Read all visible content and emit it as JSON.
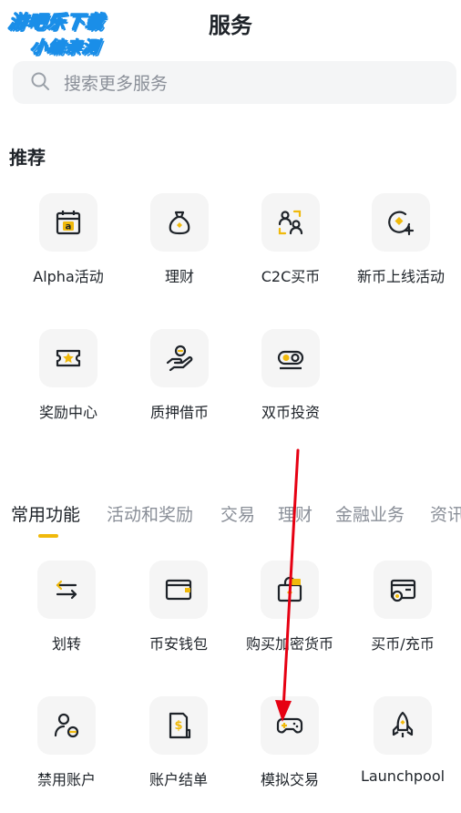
{
  "watermark": {
    "line1": "游吧乐下载",
    "line2": "小编亲测"
  },
  "header": {
    "title": "服务"
  },
  "search": {
    "placeholder": "搜索更多服务"
  },
  "recommend": {
    "title": "推荐",
    "items": [
      {
        "label": "Alpha活动",
        "icon": "alpha-calendar-icon"
      },
      {
        "label": "理财",
        "icon": "money-bag-icon"
      },
      {
        "label": "C2C买币",
        "icon": "users-exchange-icon"
      },
      {
        "label": "新币上线活动",
        "icon": "new-coin-icon"
      },
      {
        "label": "奖励中心",
        "icon": "ticket-star-icon"
      },
      {
        "label": "质押借币",
        "icon": "hand-coin-icon"
      },
      {
        "label": "双币投资",
        "icon": "dual-coin-icon"
      }
    ]
  },
  "tabs": [
    "常用功能",
    "活动和奖励",
    "交易",
    "理财",
    "金融业务",
    "资讯"
  ],
  "active_tab": "常用功能",
  "features": {
    "items": [
      {
        "label": "划转",
        "icon": "transfer-arrows-icon"
      },
      {
        "label": "币安钱包",
        "icon": "wallet-icon"
      },
      {
        "label": "购买加密货币",
        "icon": "buy-crypto-bag-icon"
      },
      {
        "label": "买币/充币",
        "icon": "card-coin-icon"
      },
      {
        "label": "禁用账户",
        "icon": "disable-account-icon"
      },
      {
        "label": "账户结单",
        "icon": "statement-icon"
      },
      {
        "label": "模拟交易",
        "icon": "gamepad-icon"
      },
      {
        "label": "Launchpool",
        "icon": "rocket-icon"
      }
    ]
  },
  "colors": {
    "accent": "#f0b90b",
    "text": "#1e2329",
    "muted": "#8a8f98",
    "tile_bg": "#f5f5f5",
    "arrow": "#e60012"
  }
}
